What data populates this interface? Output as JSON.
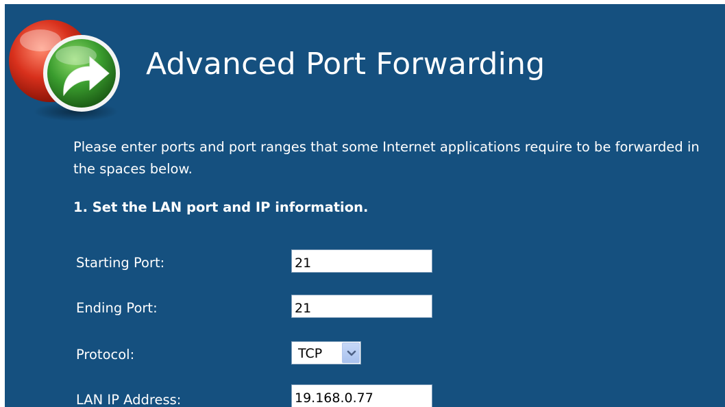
{
  "header": {
    "title": "Advanced Port Forwarding",
    "logo_icon": "forward-arrow-icon"
  },
  "intro": {
    "text": "Please enter ports and port ranges that some Internet applications require to be forwarded in the spaces below."
  },
  "section": {
    "heading": "1. Set the LAN port and IP information."
  },
  "form": {
    "starting_port": {
      "label": "Starting Port:",
      "value": "21"
    },
    "ending_port": {
      "label": "Ending Port:",
      "value": "21"
    },
    "protocol": {
      "label": "Protocol:",
      "value": "TCP"
    },
    "lan_ip": {
      "label": "LAN IP Address:",
      "value": "19.168.0.77"
    }
  },
  "colors": {
    "background": "#15507f",
    "text": "#ffffff",
    "logo_green": "#3fa43a",
    "logo_red": "#d62a1a"
  }
}
